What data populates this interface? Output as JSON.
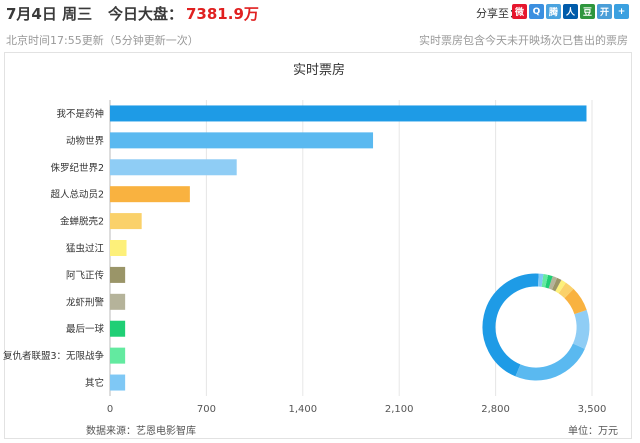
{
  "header": {
    "date": "7月4日 周三",
    "market_label": "今日大盘：",
    "market_value": "7381.9万",
    "share_label": "分享至："
  },
  "share_icons": [
    {
      "name": "weibo-icon",
      "glyph": "微",
      "color": "#e6162d"
    },
    {
      "name": "qzone-icon",
      "glyph": "Q",
      "color": "#3b8fe0"
    },
    {
      "name": "tencent-weibo-icon",
      "glyph": "腾",
      "color": "#4aa3df"
    },
    {
      "name": "renren-icon",
      "glyph": "人",
      "color": "#005baa"
    },
    {
      "name": "douban-icon",
      "glyph": "豆",
      "color": "#2e963d"
    },
    {
      "name": "kaixin-icon",
      "glyph": "开",
      "color": "#4a9ed8"
    },
    {
      "name": "more-share-icon",
      "glyph": "+",
      "color": "#3aa0e0"
    }
  ],
  "sub": {
    "update_note": "北京时间17:55更新（5分钟更新一次）",
    "coverage_note": "实时票房包含今天未开映场次已售出的票房"
  },
  "chart_data": {
    "type": "bar",
    "orientation": "horizontal",
    "title": "实时票房",
    "categories": [
      "我不是药神",
      "动物世界",
      "侏罗纪世界2",
      "超人总动员2",
      "金蝉脱壳2",
      "猛虫过江",
      "阿飞正传",
      "龙虾刑警",
      "最后一球",
      "复仇者联盟3：无限战争",
      "其它"
    ],
    "values": [
      3460,
      1910,
      920,
      580,
      230,
      120,
      110,
      110,
      110,
      110,
      110
    ],
    "colors": [
      "#1e9be6",
      "#5ab9f0",
      "#8fcdf5",
      "#f9b240",
      "#fad16a",
      "#fdf07a",
      "#9a9568",
      "#b5b39a",
      "#1fcf75",
      "#63eaa0",
      "#7fc8f5"
    ],
    "xlim": [
      0,
      3500
    ],
    "xticks": [
      0,
      700,
      1400,
      2100,
      2800,
      3500
    ],
    "xtick_labels": [
      "0",
      "700",
      "1,400",
      "2,100",
      "2,800",
      "3,500"
    ],
    "grid": true,
    "inset": {
      "type": "donut"
    },
    "source": "数据来源：艺恩电影智库",
    "unit": "单位：万元"
  }
}
